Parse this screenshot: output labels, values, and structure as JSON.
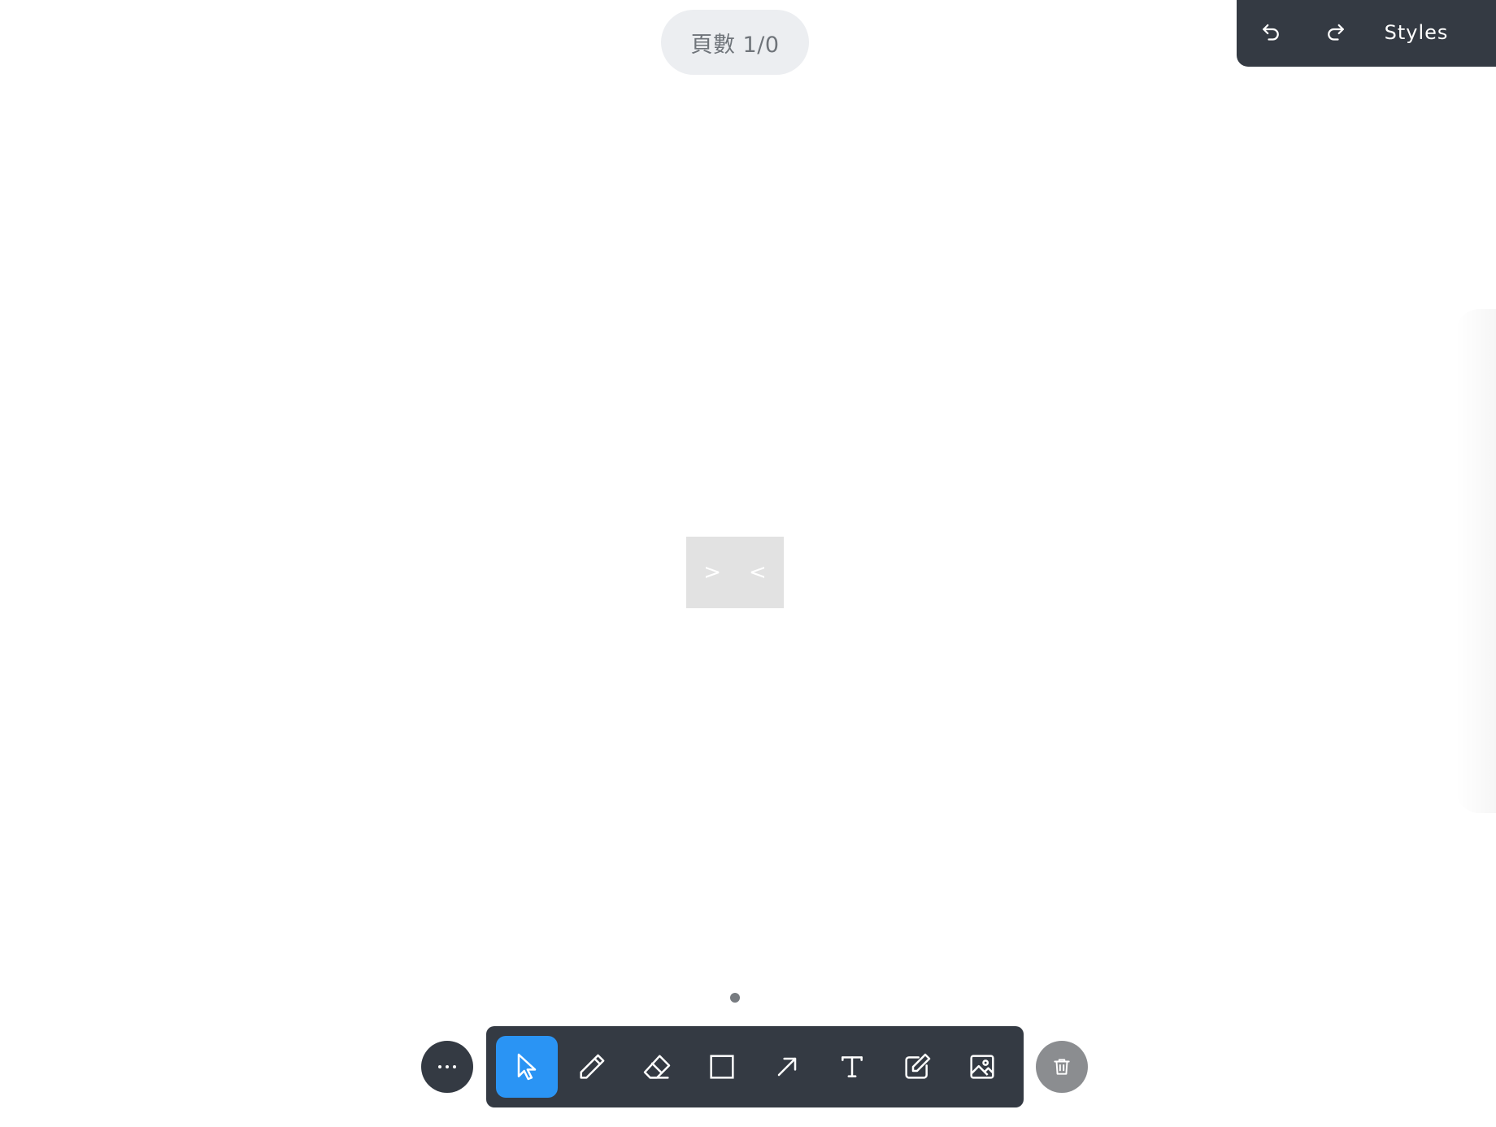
{
  "page_counter": {
    "text": "頁數 1/0"
  },
  "top_panel": {
    "undo_icon": "undo-icon",
    "redo_icon": "redo-icon",
    "styles_label": "Styles"
  },
  "canvas": {
    "center_box": {
      "next_label": ">",
      "prev_label": "<"
    }
  },
  "pagination": {
    "pages": 1,
    "current": 1
  },
  "toolbar": {
    "more_icon": "more-horizontal-icon",
    "tools": [
      {
        "name": "select",
        "icon": "cursor-icon",
        "active": true
      },
      {
        "name": "draw",
        "icon": "pencil-icon",
        "active": false
      },
      {
        "name": "eraser",
        "icon": "eraser-icon",
        "active": false
      },
      {
        "name": "rectangle",
        "icon": "rectangle-icon",
        "active": false
      },
      {
        "name": "arrow",
        "icon": "arrow-icon",
        "active": false
      },
      {
        "name": "text",
        "icon": "text-icon",
        "active": false
      },
      {
        "name": "note",
        "icon": "edit-note-icon",
        "active": false
      },
      {
        "name": "image",
        "icon": "image-icon",
        "active": false
      }
    ],
    "delete_icon": "trash-icon"
  },
  "colors": {
    "toolbar_bg": "#343a43",
    "active_tool": "#2a94f4",
    "page_counter_bg": "#eceef1",
    "page_counter_text": "#6f747a",
    "delete_bg": "#8b8d90",
    "center_box_bg": "#e2e2e2"
  }
}
